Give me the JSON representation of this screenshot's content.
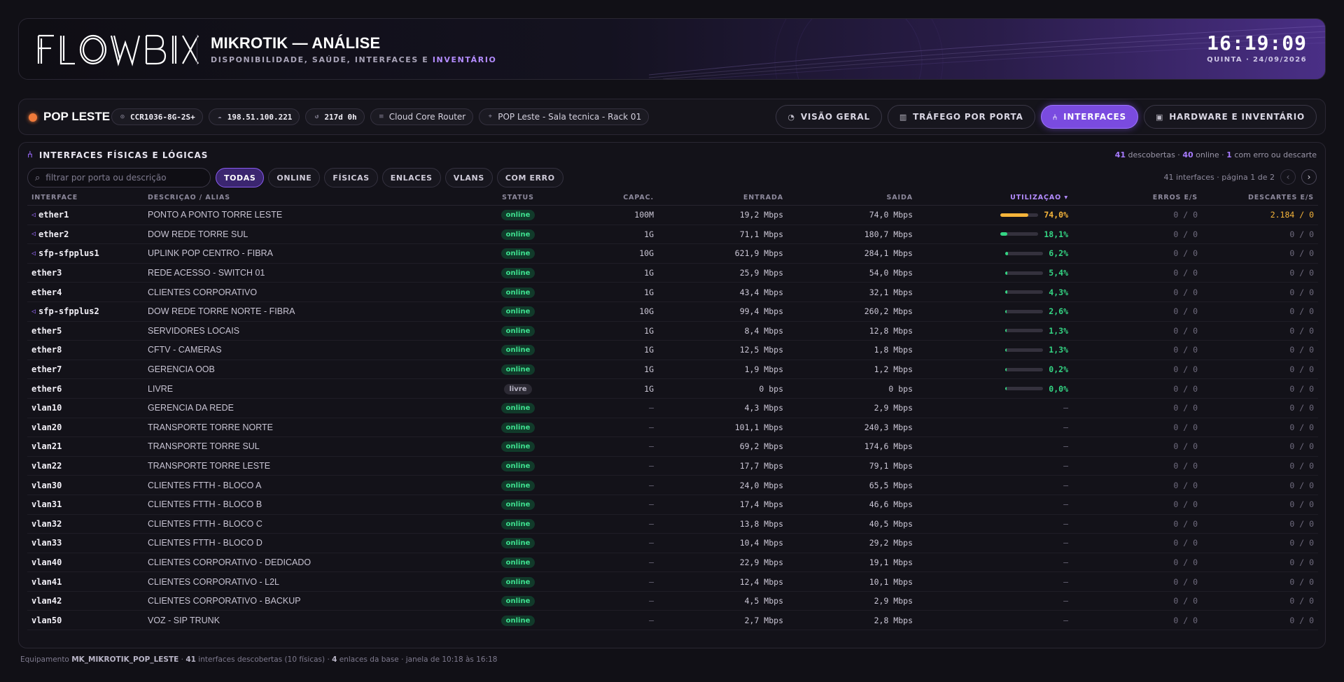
{
  "header": {
    "brand": "FLOWBIX",
    "title": "MIKROTIK — ANÁLISE",
    "subtitle_prefix": "DISPONIBILIDADE, SAÚDE, INTERFACES E ",
    "subtitle_accent": "INVENTÁRIO",
    "time": "16:19:09",
    "date": "QUINTA · 24/09/2026"
  },
  "device": {
    "name": "POP LESTE",
    "model": "CCR1036-8G-2S+",
    "ip": "198.51.100.221",
    "uptime": "217d 0h",
    "type": "Cloud Core Router",
    "location": "POP Leste - Sala tecnica - Rack 01"
  },
  "nav": {
    "tabs": [
      {
        "label": "VISÃO GERAL",
        "icon": "gauge-icon"
      },
      {
        "label": "TRÁFEGO POR PORTA",
        "icon": "chart-icon"
      },
      {
        "label": "INTERFACES",
        "icon": "network-icon",
        "active": true
      },
      {
        "label": "HARDWARE E INVENTÁRIO",
        "icon": "chip-icon"
      }
    ]
  },
  "panel": {
    "title": "INTERFACES FÍSICAS E LÓGICAS",
    "stats_discovered": "41",
    "stats_discovered_label": " descobertas · ",
    "stats_online": "40",
    "stats_online_label": " online · ",
    "stats_error": "1",
    "stats_error_label": " com erro ou descarte",
    "search_placeholder": "filtrar por porta ou descrição",
    "filters": [
      "TODAS",
      "ONLINE",
      "FÍSICAS",
      "ENLACES",
      "VLANS",
      "COM ERRO"
    ],
    "pager_text": "41 interfaces · página 1 de 2"
  },
  "table": {
    "columns": [
      "INTERFACE",
      "DESCRIÇÃO / ALIAS",
      "STATUS",
      "CAPAC.",
      "ENTRADA",
      "SAÍDA",
      "UTILIZAÇÃO ▾",
      "ERROS E/S",
      "DESCARTES E/S"
    ],
    "rows": [
      {
        "iface": "ether1",
        "link": true,
        "desc": "PONTO A PONTO TORRE LESTE",
        "status": "online",
        "cap": "100M",
        "in": "19,2 Mbps",
        "out": "74,0 Mbps",
        "util": "74,0%",
        "util_frac": 0.74,
        "util_level": "warn",
        "err": "0 / 0",
        "disc": "2.184 / 0",
        "disc_alert": true
      },
      {
        "iface": "ether2",
        "link": true,
        "desc": "DOW REDE TORRE SUL",
        "status": "online",
        "cap": "1G",
        "in": "71,1 Mbps",
        "out": "180,7 Mbps",
        "util": "18,1%",
        "util_frac": 0.181,
        "util_level": "ok",
        "err": "0 / 0",
        "disc": "0 / 0"
      },
      {
        "iface": "sfp-sfpplus1",
        "link": true,
        "desc": "UPLINK POP CENTRO - FIBRA",
        "status": "online",
        "cap": "10G",
        "in": "621,9 Mbps",
        "out": "284,1 Mbps",
        "util": "6,2%",
        "util_frac": 0.062,
        "util_level": "ok",
        "err": "0 / 0",
        "disc": "0 / 0"
      },
      {
        "iface": "ether3",
        "desc": "REDE ACESSO - SWITCH 01",
        "status": "online",
        "cap": "1G",
        "in": "25,9 Mbps",
        "out": "54,0 Mbps",
        "util": "5,4%",
        "util_frac": 0.054,
        "util_level": "ok",
        "err": "0 / 0",
        "disc": "0 / 0"
      },
      {
        "iface": "ether4",
        "desc": "CLIENTES CORPORATIVO",
        "status": "online",
        "cap": "1G",
        "in": "43,4 Mbps",
        "out": "32,1 Mbps",
        "util": "4,3%",
        "util_frac": 0.043,
        "util_level": "ok",
        "err": "0 / 0",
        "disc": "0 / 0"
      },
      {
        "iface": "sfp-sfpplus2",
        "link": true,
        "desc": "DOW REDE TORRE NORTE - FIBRA",
        "status": "online",
        "cap": "10G",
        "in": "99,4 Mbps",
        "out": "260,2 Mbps",
        "util": "2,6%",
        "util_frac": 0.026,
        "util_level": "ok",
        "err": "0 / 0",
        "disc": "0 / 0"
      },
      {
        "iface": "ether5",
        "desc": "SERVIDORES LOCAIS",
        "status": "online",
        "cap": "1G",
        "in": "8,4 Mbps",
        "out": "12,8 Mbps",
        "util": "1,3%",
        "util_frac": 0.013,
        "util_level": "ok",
        "err": "0 / 0",
        "disc": "0 / 0"
      },
      {
        "iface": "ether8",
        "desc": "CFTV - CAMERAS",
        "status": "online",
        "cap": "1G",
        "in": "12,5 Mbps",
        "out": "1,8 Mbps",
        "util": "1,3%",
        "util_frac": 0.013,
        "util_level": "ok",
        "err": "0 / 0",
        "disc": "0 / 0"
      },
      {
        "iface": "ether7",
        "desc": "GERENCIA OOB",
        "status": "online",
        "cap": "1G",
        "in": "1,9 Mbps",
        "out": "1,2 Mbps",
        "util": "0,2%",
        "util_frac": 0.002,
        "util_level": "ok",
        "err": "0 / 0",
        "disc": "0 / 0"
      },
      {
        "iface": "ether6",
        "desc": "LIVRE",
        "status": "livre",
        "cap": "1G",
        "in": "0 bps",
        "out": "0 bps",
        "util": "0,0%",
        "util_frac": 0.0,
        "util_level": "ok",
        "err": "0 / 0",
        "disc": "0 / 0"
      },
      {
        "iface": "vlan10",
        "desc": "GERENCIA DA REDE",
        "status": "online",
        "cap": "—",
        "in": "4,3 Mbps",
        "out": "2,9 Mbps",
        "util": "—",
        "err": "0 / 0",
        "disc": "0 / 0"
      },
      {
        "iface": "vlan20",
        "desc": "TRANSPORTE TORRE NORTE",
        "status": "online",
        "cap": "—",
        "in": "101,1 Mbps",
        "out": "240,3 Mbps",
        "util": "—",
        "err": "0 / 0",
        "disc": "0 / 0"
      },
      {
        "iface": "vlan21",
        "desc": "TRANSPORTE TORRE SUL",
        "status": "online",
        "cap": "—",
        "in": "69,2 Mbps",
        "out": "174,6 Mbps",
        "util": "—",
        "err": "0 / 0",
        "disc": "0 / 0"
      },
      {
        "iface": "vlan22",
        "desc": "TRANSPORTE TORRE LESTE",
        "status": "online",
        "cap": "—",
        "in": "17,7 Mbps",
        "out": "79,1 Mbps",
        "util": "—",
        "err": "0 / 0",
        "disc": "0 / 0"
      },
      {
        "iface": "vlan30",
        "desc": "CLIENTES FTTH - BLOCO A",
        "status": "online",
        "cap": "—",
        "in": "24,0 Mbps",
        "out": "65,5 Mbps",
        "util": "—",
        "err": "0 / 0",
        "disc": "0 / 0"
      },
      {
        "iface": "vlan31",
        "desc": "CLIENTES FTTH - BLOCO B",
        "status": "online",
        "cap": "—",
        "in": "17,4 Mbps",
        "out": "46,6 Mbps",
        "util": "—",
        "err": "0 / 0",
        "disc": "0 / 0"
      },
      {
        "iface": "vlan32",
        "desc": "CLIENTES FTTH - BLOCO C",
        "status": "online",
        "cap": "—",
        "in": "13,8 Mbps",
        "out": "40,5 Mbps",
        "util": "—",
        "err": "0 / 0",
        "disc": "0 / 0"
      },
      {
        "iface": "vlan33",
        "desc": "CLIENTES FTTH - BLOCO D",
        "status": "online",
        "cap": "—",
        "in": "10,4 Mbps",
        "out": "29,2 Mbps",
        "util": "—",
        "err": "0 / 0",
        "disc": "0 / 0"
      },
      {
        "iface": "vlan40",
        "desc": "CLIENTES CORPORATIVO - DEDICADO",
        "status": "online",
        "cap": "—",
        "in": "22,9 Mbps",
        "out": "19,1 Mbps",
        "util": "—",
        "err": "0 / 0",
        "disc": "0 / 0"
      },
      {
        "iface": "vlan41",
        "desc": "CLIENTES CORPORATIVO - L2L",
        "status": "online",
        "cap": "—",
        "in": "12,4 Mbps",
        "out": "10,1 Mbps",
        "util": "—",
        "err": "0 / 0",
        "disc": "0 / 0"
      },
      {
        "iface": "vlan42",
        "desc": "CLIENTES CORPORATIVO - BACKUP",
        "status": "online",
        "cap": "—",
        "in": "4,5 Mbps",
        "out": "2,9 Mbps",
        "util": "—",
        "err": "0 / 0",
        "disc": "0 / 0"
      },
      {
        "iface": "vlan50",
        "desc": "VOZ - SIP TRUNK",
        "status": "online",
        "cap": "—",
        "in": "2,7 Mbps",
        "out": "2,8 Mbps",
        "util": "—",
        "err": "0 / 0",
        "disc": "0 / 0"
      }
    ]
  },
  "footer": {
    "p1": "Equipamento ",
    "device_id": "MK_MIKROTIK_POP_LESTE",
    "p2": " · ",
    "discovered": "41",
    "p3": " interfaces descobertas (10 físicas) · ",
    "links": "4",
    "p4": " enlaces da base · janela de 10:18 às 16:18"
  },
  "colors": {
    "accent": "#7a4be0",
    "online": "#3ee08f",
    "warn": "#f5b43a",
    "ok": "#34d684"
  }
}
